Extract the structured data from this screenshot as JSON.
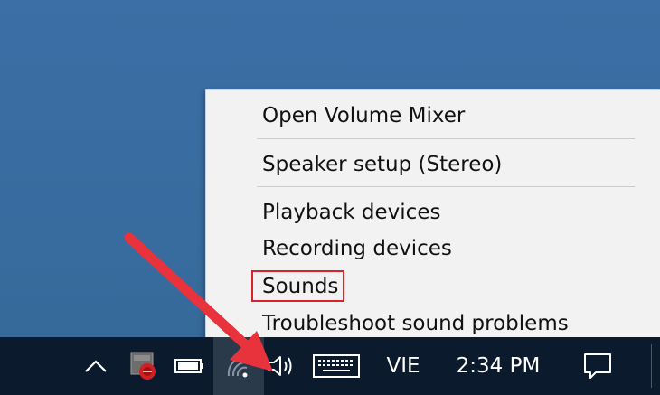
{
  "context_menu": {
    "items": [
      {
        "label": "Open Volume Mixer"
      },
      {
        "label": "Speaker setup (Stereo)"
      },
      {
        "label": "Playback devices"
      },
      {
        "label": "Recording devices"
      },
      {
        "label": "Sounds"
      },
      {
        "label": "Troubleshoot sound problems"
      }
    ]
  },
  "taskbar": {
    "language": "VIE",
    "time": "2:34 PM"
  },
  "colors": {
    "desktop": "#3b6fa5",
    "taskbar": "#0b1a2d",
    "menu_bg": "#f2f2f2",
    "highlight_box": "#d9232d",
    "arrow": "#e8323c"
  },
  "icons": [
    "chevron-up-icon",
    "security-app-icon",
    "battery-icon",
    "wifi-icon",
    "speaker-icon",
    "keyboard-icon",
    "action-center-icon"
  ]
}
